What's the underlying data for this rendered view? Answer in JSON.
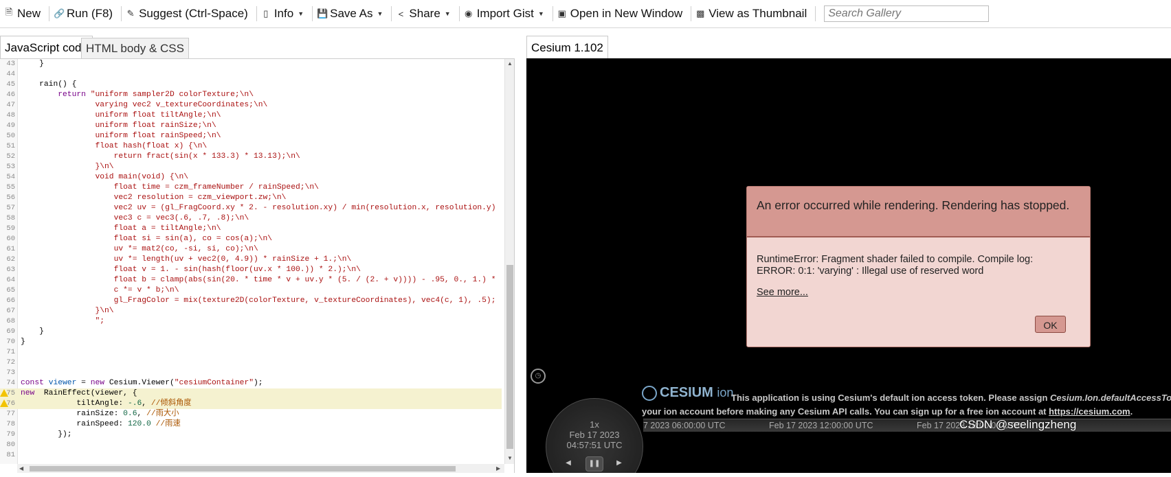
{
  "toolbar": {
    "new": "New",
    "run": "Run (F8)",
    "suggest": "Suggest (Ctrl-Space)",
    "info": "Info",
    "save_as": "Save As",
    "share": "Share",
    "import_gist": "Import Gist",
    "open_new_window": "Open in New Window",
    "view_thumbnail": "View as Thumbnail",
    "search_placeholder": "Search Gallery"
  },
  "editor_tabs": [
    "JavaScript code",
    "HTML body & CSS"
  ],
  "viewer_tab": "Cesium 1.102",
  "code_lines": [
    {
      "n": "43",
      "t": "    }"
    },
    {
      "n": "44",
      "t": ""
    },
    {
      "n": "45",
      "t": "    rain() {"
    },
    {
      "n": "46",
      "t": "        return \"uniform sampler2D colorTexture;\\n\\"
    },
    {
      "n": "47",
      "t": "                varying vec2 v_textureCoordinates;\\n\\"
    },
    {
      "n": "48",
      "t": "                uniform float tiltAngle;\\n\\"
    },
    {
      "n": "49",
      "t": "                uniform float rainSize;\\n\\"
    },
    {
      "n": "50",
      "t": "                uniform float rainSpeed;\\n\\"
    },
    {
      "n": "51",
      "t": "                float hash(float x) {\\n\\"
    },
    {
      "n": "52",
      "t": "                    return fract(sin(x * 133.3) * 13.13);\\n\\"
    },
    {
      "n": "53",
      "t": "                }\\n\\"
    },
    {
      "n": "54",
      "t": "                void main(void) {\\n\\"
    },
    {
      "n": "55",
      "t": "                    float time = czm_frameNumber / rainSpeed;\\n\\"
    },
    {
      "n": "56",
      "t": "                    vec2 resolution = czm_viewport.zw;\\n\\"
    },
    {
      "n": "57",
      "t": "                    vec2 uv = (gl_FragCoord.xy * 2. - resolution.xy) / min(resolution.x, resolution.y)"
    },
    {
      "n": "58",
      "t": "                    vec3 c = vec3(.6, .7, .8);\\n\\"
    },
    {
      "n": "59",
      "t": "                    float a = tiltAngle;\\n\\"
    },
    {
      "n": "60",
      "t": "                    float si = sin(a), co = cos(a);\\n\\"
    },
    {
      "n": "61",
      "t": "                    uv *= mat2(co, -si, si, co);\\n\\"
    },
    {
      "n": "62",
      "t": "                    uv *= length(uv + vec2(0, 4.9)) * rainSize + 1.;\\n\\"
    },
    {
      "n": "63",
      "t": "                    float v = 1. - sin(hash(floor(uv.x * 100.)) * 2.);\\n\\"
    },
    {
      "n": "64",
      "t": "                    float b = clamp(abs(sin(20. * time * v + uv.y * (5. / (2. + v)))) - .95, 0., 1.) *"
    },
    {
      "n": "65",
      "t": "                    c *= v * b;\\n\\"
    },
    {
      "n": "66",
      "t": "                    gl_FragColor = mix(texture2D(colorTexture, v_textureCoordinates), vec4(c, 1), .5);"
    },
    {
      "n": "67",
      "t": "                }\\n\\"
    },
    {
      "n": "68",
      "t": "                \";"
    },
    {
      "n": "69",
      "t": "    }"
    },
    {
      "n": "70",
      "t": "}"
    },
    {
      "n": "71",
      "t": ""
    },
    {
      "n": "72",
      "t": ""
    },
    {
      "n": "73",
      "t": ""
    },
    {
      "n": "74",
      "t": "const viewer = new Cesium.Viewer(\"cesiumContainer\");"
    },
    {
      "n": "75",
      "t": "new  RainEffect(viewer, {",
      "warn": true
    },
    {
      "n": "76",
      "t": "            tiltAngle: -.6, //倾斜角度",
      "warn": true
    },
    {
      "n": "77",
      "t": "            rainSize: 0.6, //雨大小"
    },
    {
      "n": "78",
      "t": "            rainSpeed: 120.0 //雨速"
    },
    {
      "n": "79",
      "t": "        });"
    },
    {
      "n": "80",
      "t": ""
    },
    {
      "n": "81",
      "t": ""
    }
  ],
  "error_dialog": {
    "title": "An error occurred while rendering. Rendering has stopped.",
    "message_line1": "RuntimeError: Fragment shader failed to compile.  Compile log:",
    "message_line2": "ERROR: 0:1: 'varying' : Illegal use of reserved word",
    "see_more": "See more...",
    "ok": "OK"
  },
  "animation": {
    "speed": "1x",
    "date": "Feb 17 2023",
    "time": "04:57:51 UTC"
  },
  "credits": {
    "logo": "CESIUM",
    "logo_suffix": "ion",
    "line1_a": "This application is using Cesium's default ion access token. Please assign ",
    "line1_b": "Cesium.Ion.defaultAccessTok",
    "line2_a": "your ion account before making any Cesium API calls. You can sign up for a free ion account at ",
    "line2_link": "https://cesium.com",
    "line2_end": "."
  },
  "timeline_labels": [
    "7 2023 06:00:00 UTC",
    "Feb 17 2023 12:00:00 UTC",
    "Feb 17 2023 18:00:00 UTC"
  ],
  "watermark": "CSDN @seelingzheng"
}
